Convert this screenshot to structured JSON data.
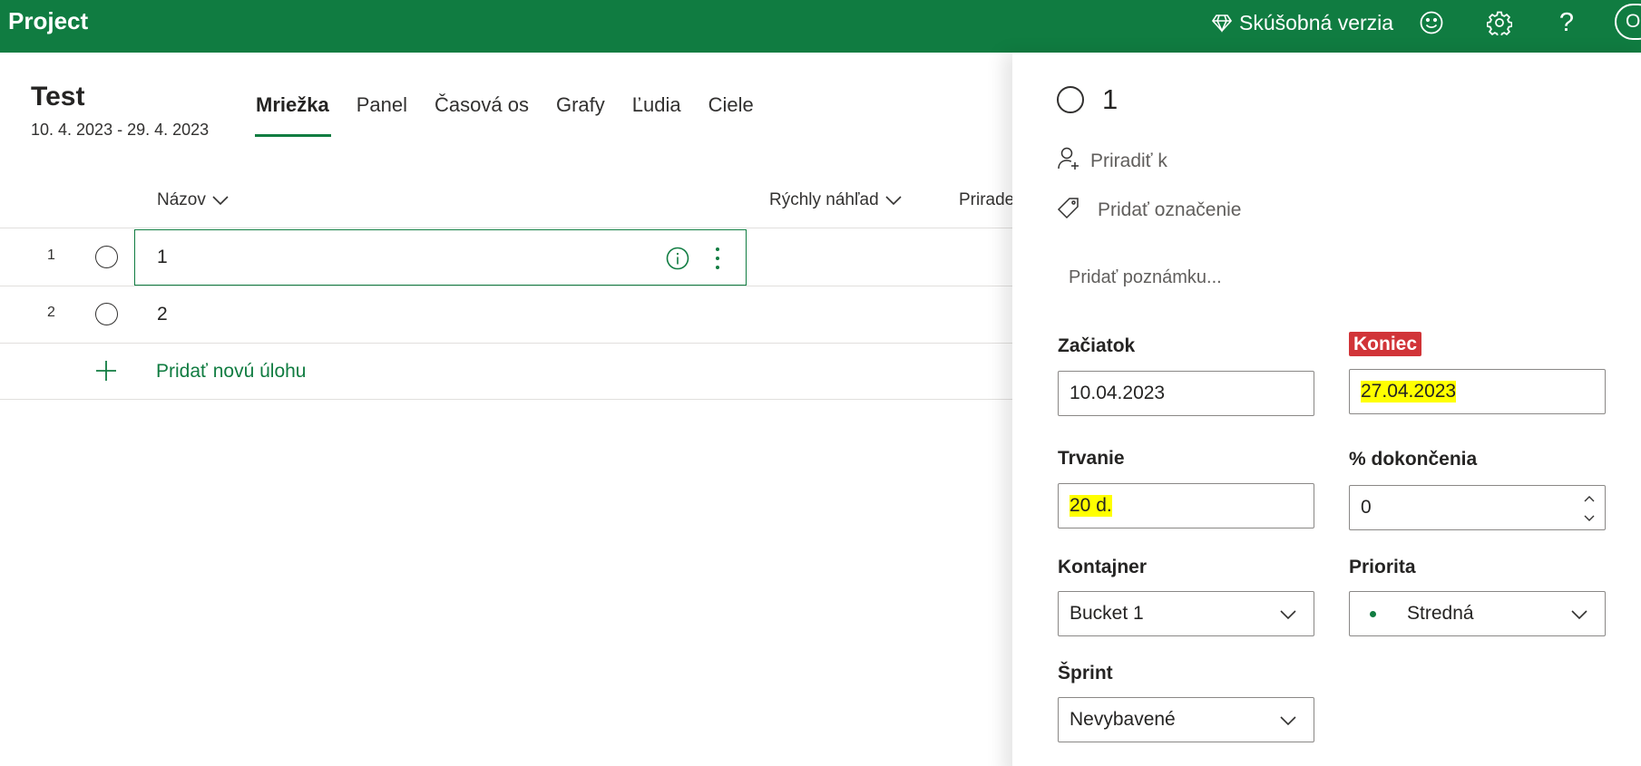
{
  "topbar": {
    "app_name": "Project",
    "trial_label": "Skúšobná verzia",
    "avatar_initials": "OS"
  },
  "header": {
    "project_title": "Test",
    "date_range": "10. 4. 2023 - 29. 4. 2023"
  },
  "tabs": [
    {
      "label": "Mriežka",
      "active": true
    },
    {
      "label": "Panel",
      "active": false
    },
    {
      "label": "Časová os",
      "active": false
    },
    {
      "label": "Grafy",
      "active": false
    },
    {
      "label": "Ľudia",
      "active": false
    },
    {
      "label": "Ciele",
      "active": false
    }
  ],
  "grid": {
    "columns": {
      "name": "Názov",
      "quick_view": "Rýchly náhľad",
      "assigned": "Priradené"
    },
    "rows": [
      {
        "num": "1",
        "title": "1"
      },
      {
        "num": "2",
        "title": "2"
      }
    ],
    "add_task": "Pridať novú úlohu"
  },
  "panel": {
    "task_title": "1",
    "assign_placeholder": "Priradiť k",
    "label_placeholder": "Pridať označenie",
    "note_placeholder": "Pridať poznámku...",
    "start": {
      "label": "Začiatok",
      "value": "10.04.2023"
    },
    "end": {
      "label": "Koniec",
      "value": "27.04.2023"
    },
    "duration": {
      "label": "Trvanie",
      "value": "20 d."
    },
    "percent": {
      "label": "% dokončenia",
      "value": "0"
    },
    "bucket": {
      "label": "Kontajner",
      "value": "Bucket 1"
    },
    "priority": {
      "label": "Priorita",
      "value": "Stredná"
    },
    "sprint": {
      "label": "Šprint",
      "value": "Nevybavené"
    }
  },
  "colors": {
    "brand": "#107c41",
    "highlight": "#ffff00",
    "end_label_bg": "#d13438"
  }
}
